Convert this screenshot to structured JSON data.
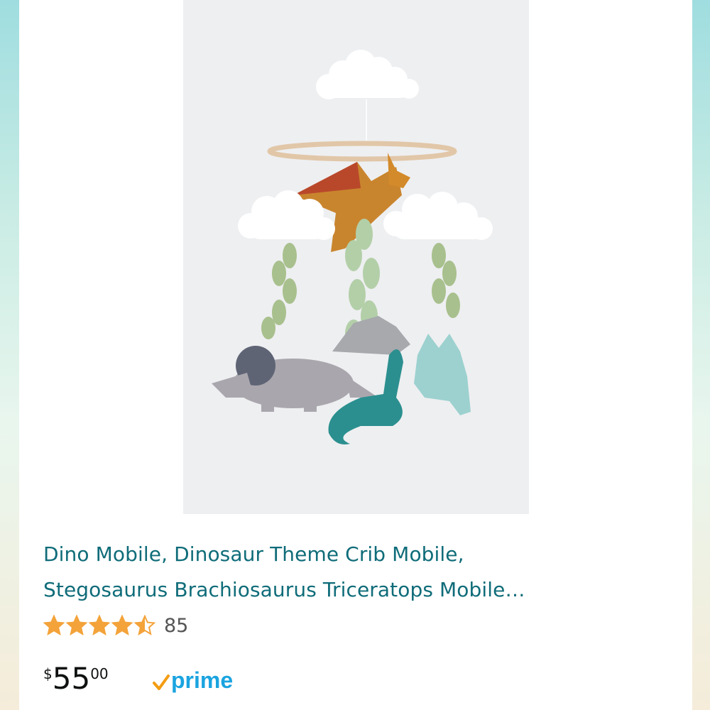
{
  "product": {
    "image_alt_icon": "dinosaur-mobile-image",
    "title_line1": "Dino Mobile, Dinosaur Theme Crib Mobile,",
    "title_line2": "Stegosaurus Brachiosaurus Triceratops Mobile…",
    "rating": 4.5,
    "rating_max": 5,
    "rating_count": "85",
    "price": {
      "currency": "$",
      "whole": "55",
      "fraction": "00"
    },
    "prime_label": "prime"
  },
  "colors": {
    "title": "#0f6c79",
    "star": "#f3a33a",
    "prime": "#1aa4e0",
    "prime_check": "#f39c12"
  }
}
